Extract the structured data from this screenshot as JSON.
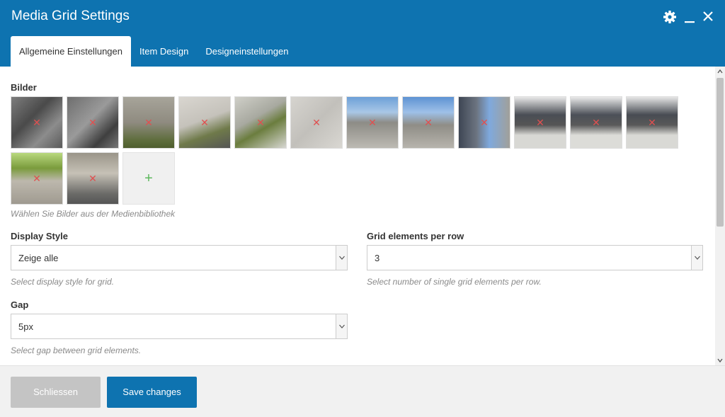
{
  "window": {
    "title": "Media Grid Settings"
  },
  "tabs": [
    {
      "label": "Allgemeine Einstellungen",
      "active": true
    },
    {
      "label": "Item Design",
      "active": false
    },
    {
      "label": "Designeinstellungen",
      "active": false
    }
  ],
  "icons": {
    "settings": "gear-icon",
    "minimize": "minimize-icon",
    "close": "close-icon",
    "remove": "remove-x-icon",
    "add": "plus-icon"
  },
  "images": {
    "label": "Bilder",
    "remove_glyph": "✕",
    "add_glyph": "+",
    "help": "Wählen Sie Bilder aus der Medienbibliothek",
    "count": 14
  },
  "display_style": {
    "label": "Display Style",
    "value": "Zeige alle",
    "help": "Select display style for grid."
  },
  "grid_per_row": {
    "label": "Grid elements per row",
    "value": "3",
    "help": "Select number of single grid elements per row."
  },
  "gap": {
    "label": "Gap",
    "value": "5px",
    "help": "Select gap between grid elements."
  },
  "footer": {
    "close_label": "Schliessen",
    "save_label": "Save changes"
  },
  "colors": {
    "header": "#0e73b0",
    "remove": "#e05050",
    "add": "#5cb85c",
    "disabled_button": "#c4c4c4",
    "primary_button": "#0e73b0"
  }
}
